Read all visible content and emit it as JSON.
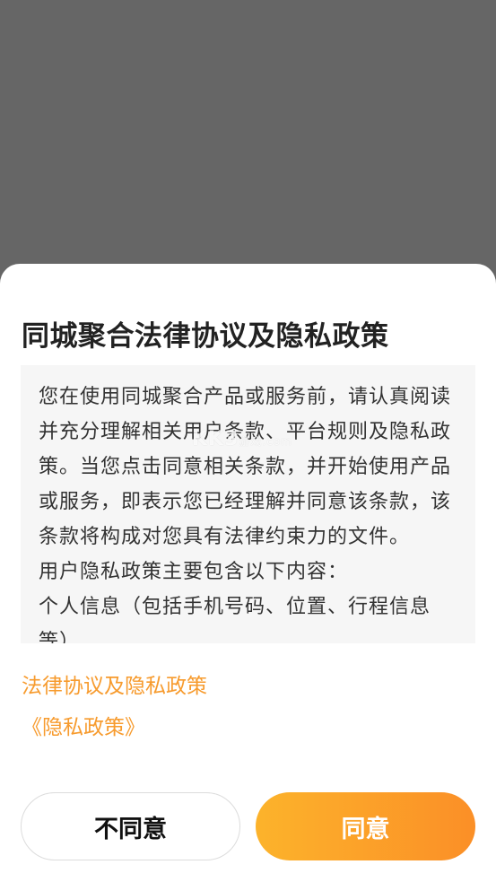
{
  "dialog": {
    "title": "同城聚合法律协议及隐私政策",
    "content": {
      "paragraph1": "您在使用同城聚合产品或服务前，请认真阅读并充分理解相关用户条款、平台规则及隐私政策。当您点击同意相关条款，并开始使用产品或服务，即表示您已经理解并同意该条款，该条款将构成对您具有法律约束力的文件。",
      "paragraph2": "用户隐私政策主要包含以下内容：",
      "paragraph3": "个人信息（包括手机号码、位置、行程信息等）"
    },
    "watermark": {
      "text": "KK3",
      "sub": "游戏",
      "domain": ".com"
    },
    "links": {
      "legal": "法律协议及隐私政策",
      "privacy": "《隐私政策》"
    },
    "buttons": {
      "disagree": "不同意",
      "agree": "同意"
    }
  },
  "colors": {
    "overlay": "#666666",
    "link": "#f79b2e",
    "agree_gradient_start": "#fcb32b",
    "agree_gradient_end": "#fb8f27",
    "content_bg": "#f6f6f6"
  }
}
